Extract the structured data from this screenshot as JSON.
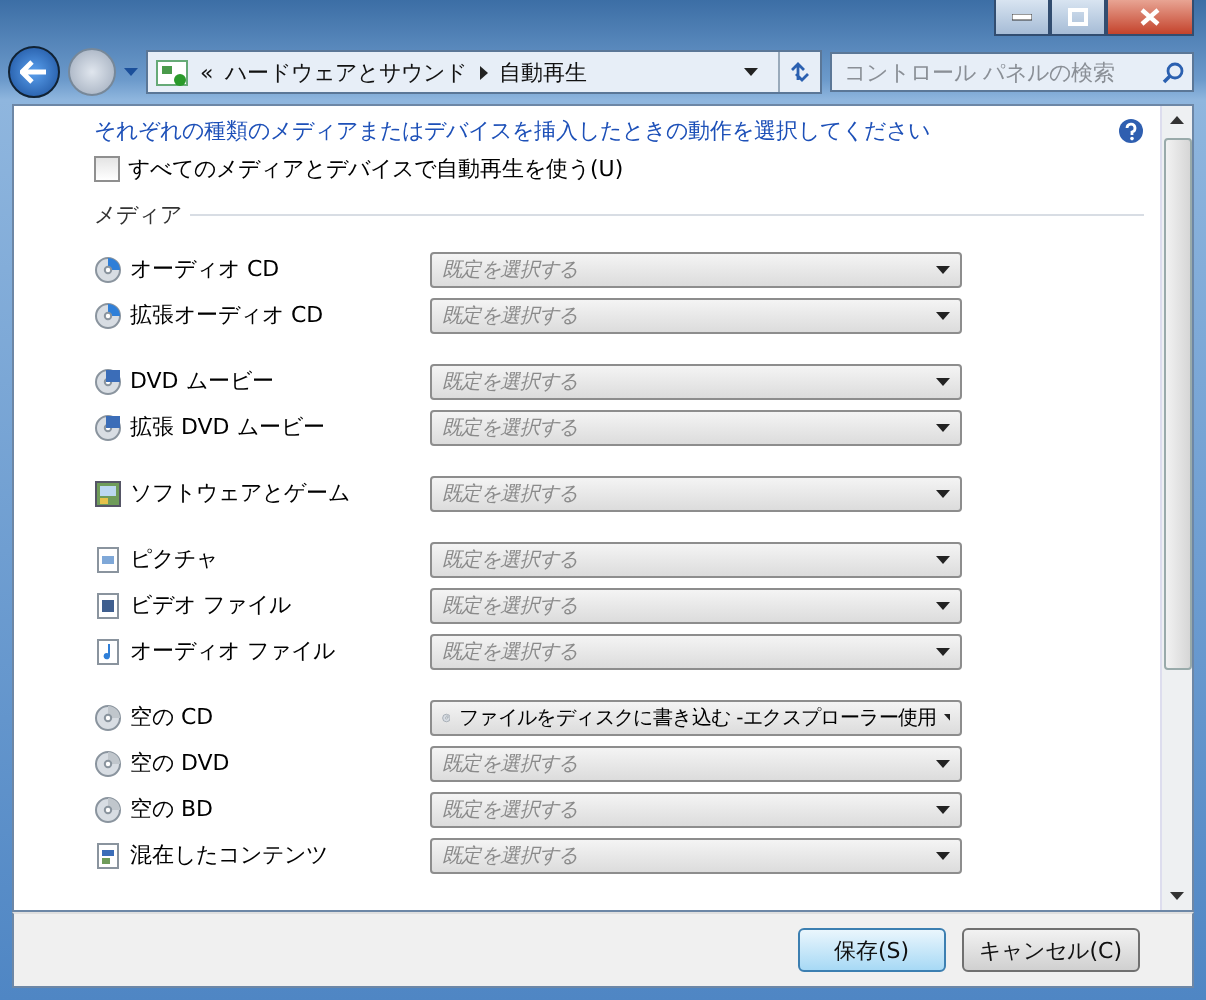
{
  "nav": {
    "breadcrumb": [
      "«",
      "ハードウェアとサウンド",
      "自動再生"
    ]
  },
  "search": {
    "placeholder": "コントロール パネルの検索"
  },
  "instruction": "それぞれの種類のメディアまたはデバイスを挿入したときの動作を選択してください",
  "autoplay_all": {
    "label": "すべてのメディアとデバイスで自動再生を使う(U)",
    "checked": false
  },
  "section": "メディア",
  "groups": [
    [
      {
        "kind": "cd",
        "label": "オーディオ CD",
        "placeholder": "既定を選択する"
      },
      {
        "kind": "cd",
        "label": "拡張オーディオ CD",
        "placeholder": "既定を選択する"
      }
    ],
    [
      {
        "kind": "dvd",
        "label": "DVD ムービー",
        "placeholder": "既定を選択する"
      },
      {
        "kind": "dvd",
        "label": "拡張 DVD ムービー",
        "placeholder": "既定を選択する"
      }
    ],
    [
      {
        "kind": "software",
        "label": "ソフトウェアとゲーム",
        "placeholder": "既定を選択する"
      }
    ],
    [
      {
        "kind": "picture",
        "label": "ピクチャ",
        "placeholder": "既定を選択する"
      },
      {
        "kind": "video",
        "label": "ビデオ ファイル",
        "placeholder": "既定を選択する"
      },
      {
        "kind": "audio",
        "label": "オーディオ ファイル",
        "placeholder": "既定を選択する"
      }
    ],
    [
      {
        "kind": "blank",
        "label": "空の CD",
        "value": "ファイルをディスクに書き込む -エクスプローラー使用"
      },
      {
        "kind": "blank",
        "label": "空の DVD",
        "placeholder": "既定を選択する"
      },
      {
        "kind": "blank",
        "label": "空の BD",
        "placeholder": "既定を選択する"
      },
      {
        "kind": "mixed",
        "label": "混在したコンテンツ",
        "placeholder": "既定を選択する"
      }
    ]
  ],
  "buttons": [
    {
      "label": "保存(S)",
      "default": true
    },
    {
      "label": "キャンセル(C)",
      "default": false
    }
  ]
}
